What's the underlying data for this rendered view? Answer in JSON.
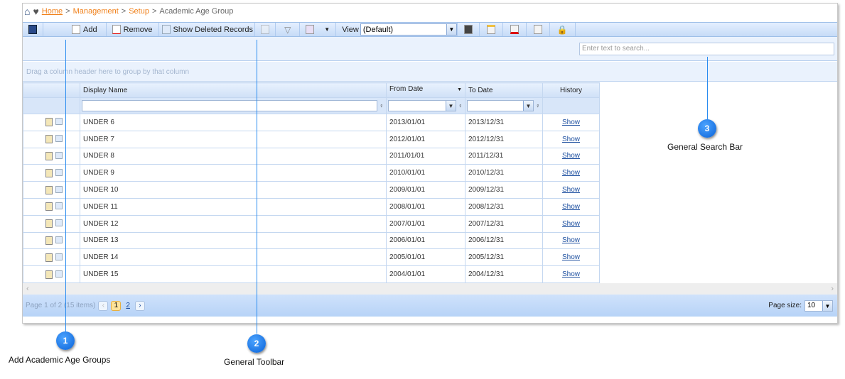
{
  "breadcrumb": {
    "items": [
      "Home",
      "Management",
      "Setup"
    ],
    "current": "Academic Age Group",
    "separator": ">"
  },
  "toolbar": {
    "add": "Add",
    "remove": "Remove",
    "show_deleted": "Show Deleted Records",
    "view_label": "View",
    "view_value": "(Default)"
  },
  "search": {
    "placeholder": "Enter text to search..."
  },
  "group_hint": "Drag a column header here to group by that column",
  "grid": {
    "columns": [
      "Display Name",
      "From Date",
      "To Date",
      "History"
    ],
    "rows": [
      {
        "name": "UNDER 6",
        "from": "2013/01/01",
        "to": "2013/12/31",
        "history": "Show"
      },
      {
        "name": "UNDER 7",
        "from": "2012/01/01",
        "to": "2012/12/31",
        "history": "Show"
      },
      {
        "name": "UNDER 8",
        "from": "2011/01/01",
        "to": "2011/12/31",
        "history": "Show"
      },
      {
        "name": "UNDER 9",
        "from": "2010/01/01",
        "to": "2010/12/31",
        "history": "Show"
      },
      {
        "name": "UNDER 10",
        "from": "2009/01/01",
        "to": "2009/12/31",
        "history": "Show"
      },
      {
        "name": "UNDER 11",
        "from": "2008/01/01",
        "to": "2008/12/31",
        "history": "Show"
      },
      {
        "name": "UNDER 12",
        "from": "2007/01/01",
        "to": "2007/12/31",
        "history": "Show"
      },
      {
        "name": "UNDER 13",
        "from": "2006/01/01",
        "to": "2006/12/31",
        "history": "Show"
      },
      {
        "name": "UNDER 14",
        "from": "2005/01/01",
        "to": "2005/12/31",
        "history": "Show"
      },
      {
        "name": "UNDER 15",
        "from": "2004/01/01",
        "to": "2004/12/31",
        "history": "Show"
      }
    ]
  },
  "pager": {
    "info": "Page 1 of 2 (15 items)",
    "pages": [
      "1",
      "2"
    ],
    "current_page": "1",
    "page_size_label": "Page size:",
    "page_size": "10"
  },
  "callouts": [
    {
      "number": "1",
      "label": "Add Academic Age Groups"
    },
    {
      "number": "2",
      "label": "General Toolbar"
    },
    {
      "number": "3",
      "label": "General Search Bar"
    }
  ],
  "colors": {
    "link_orange": "#f0801a",
    "callout_blue": "#0a62d8",
    "toolbar_blue": "#c6dbf7"
  }
}
